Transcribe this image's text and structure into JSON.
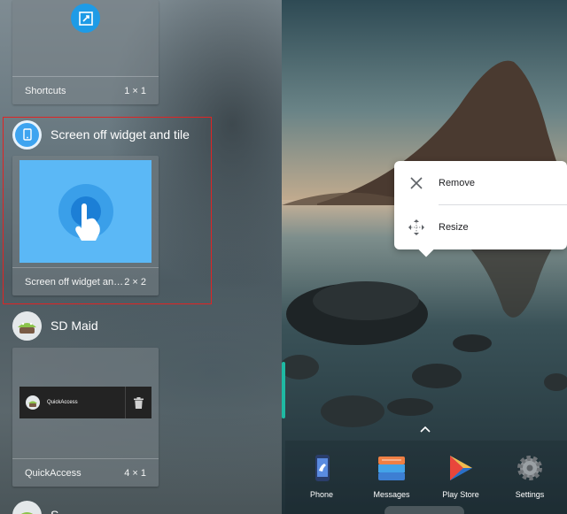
{
  "widget_picker": {
    "shortcuts_widget": {
      "name": "Shortcuts",
      "size": "1 × 1"
    },
    "screen_off_app": {
      "title": "Screen off widget and tile",
      "widget_name": "Screen off widget an…",
      "size": "2 × 2"
    },
    "sd_maid_app": {
      "title": "SD Maid",
      "widget_label": "QuickAccess",
      "widget_name": "QuickAccess",
      "size": "4 × 1"
    },
    "partial_next_label": "S"
  },
  "context_menu": {
    "remove_label": "Remove",
    "resize_label": "Resize"
  },
  "dock": {
    "items": [
      {
        "label": "Phone"
      },
      {
        "label": "Messages"
      },
      {
        "label": "Play Store"
      },
      {
        "label": "Settings"
      }
    ]
  },
  "colors": {
    "highlight": "#e02424",
    "edge_handle": "#1fb9a3",
    "widget_blue": "#2196f3"
  }
}
